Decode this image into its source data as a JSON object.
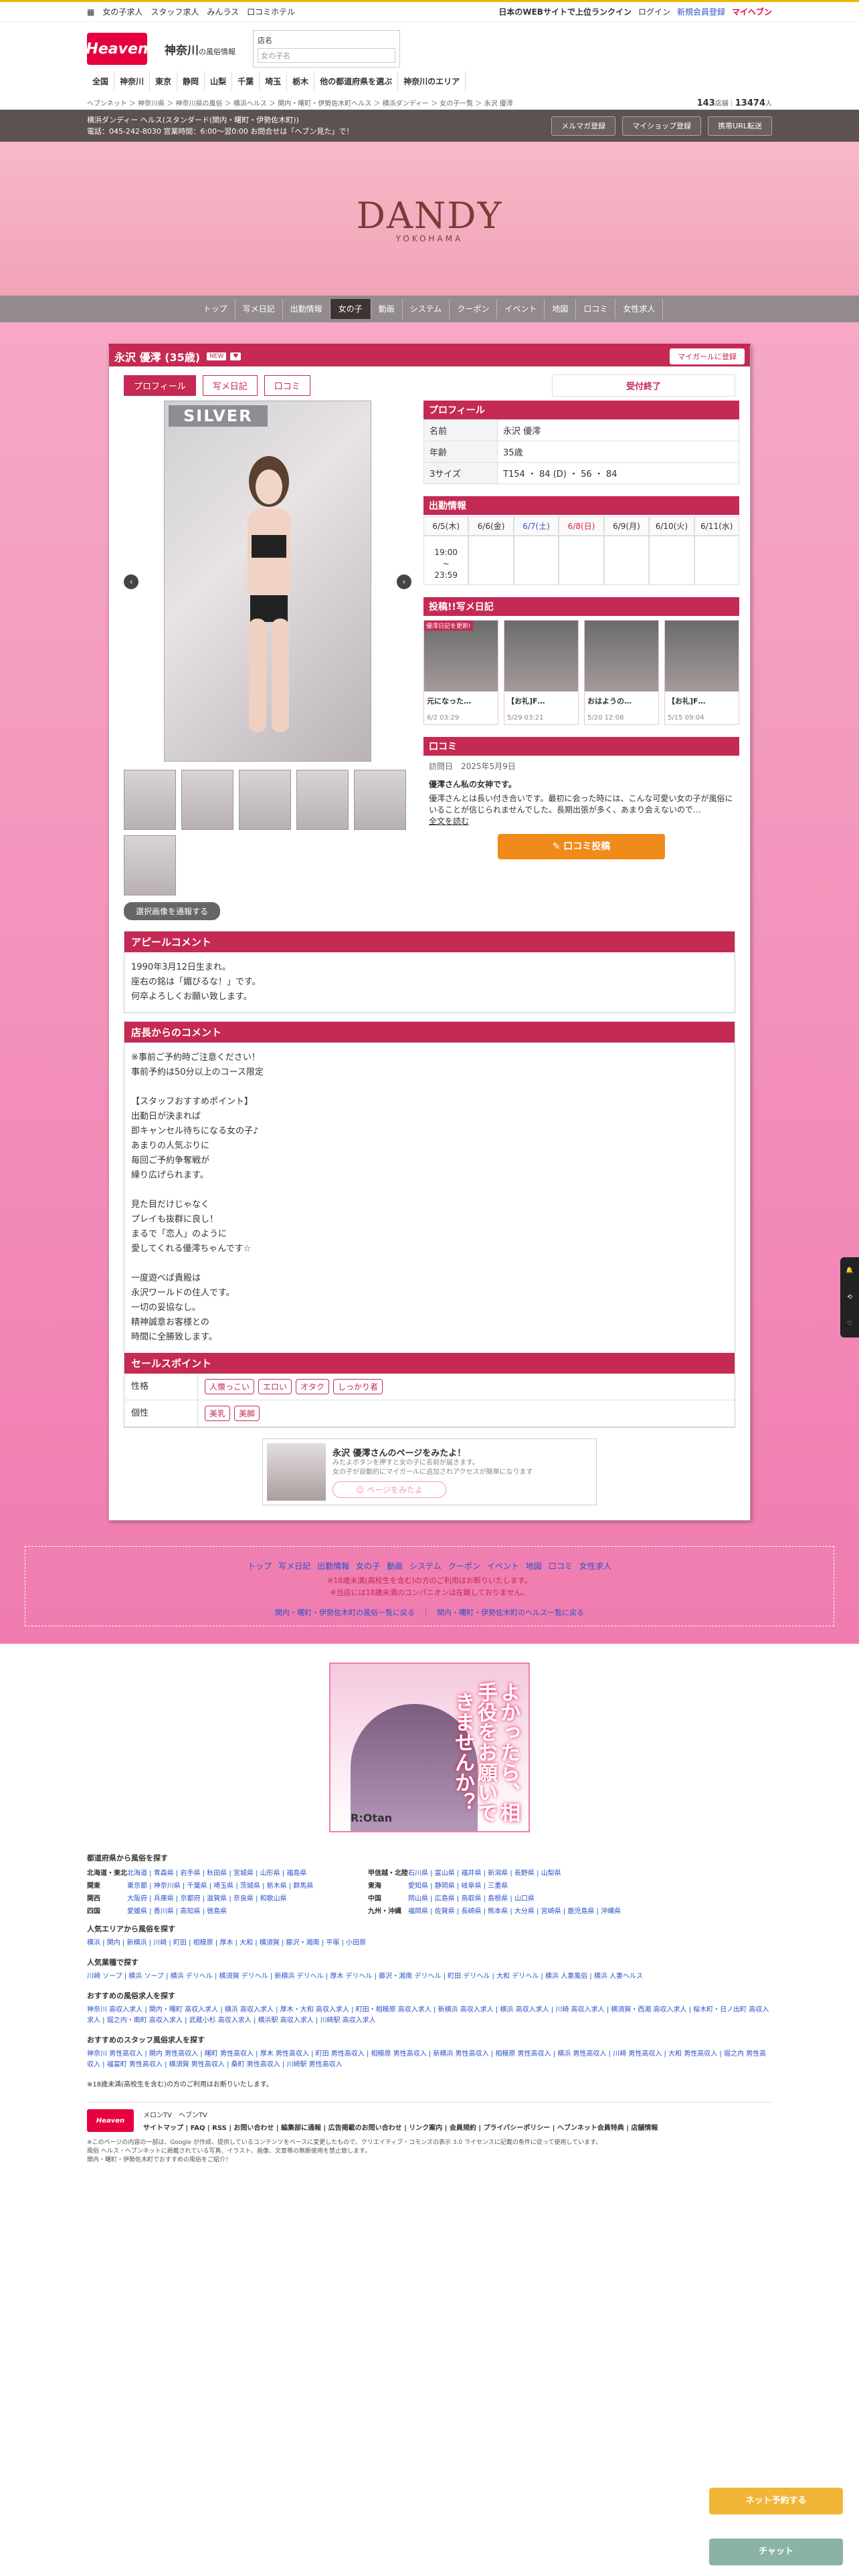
{
  "top": {
    "links": [
      "女の子求人",
      "スタッフ求人",
      "みんラス",
      "口コミホテル"
    ],
    "right_text": "日本のWEBサイトで上位ランクイン",
    "login": "ログイン",
    "register": "新規会員登録",
    "myheaven": "マイヘブン"
  },
  "logo": {
    "text": "Heaven",
    "region": "神奈川",
    "region_sub": "の風俗情報"
  },
  "search": {
    "label": "店名",
    "placeholder": "女の子名"
  },
  "gnav": [
    "全国",
    "神奈川",
    "東京",
    "静岡",
    "山梨",
    "千葉",
    "埼玉",
    "栃木",
    "他の都道府県を選ぶ",
    "神奈川のエリア"
  ],
  "breadcrumb": "ヘブンネット ＞ 神奈川県 ＞ 神奈川県の風俗 ＞ 横浜ヘルス ＞ 関内・曙町・伊勢佐木町ヘルス ＞ 横浜ダンディー ＞ 女の子一覧 ＞ 永沢 優澪",
  "counts": {
    "a": "143",
    "a_unit": "店舗",
    "b": "13474",
    "b_unit": "人"
  },
  "shop": {
    "line1": "横浜ダンディー ヘルス(スタンダード(関内・曙町・伊勢佐木町))",
    "line2": "電話：045-242-8030 営業時間：6:00～翌0:00 お問合せは「ヘブン見た」で！",
    "btn_mail": "メルマガ登録",
    "btn_myshop": "マイショップ登録",
    "btn_url": "携帯URL転送"
  },
  "brand": {
    "name": "DANDY",
    "sub": "YOKOHAMA"
  },
  "snav": [
    "トップ",
    "写メ日記",
    "出勤情報",
    "女の子",
    "動画",
    "システム",
    "クーポン",
    "イベント",
    "地図",
    "口コミ",
    "女性求人"
  ],
  "girl": {
    "name": "永沢 優澪 (35歳)",
    "badges": [
      "NEW",
      "♥"
    ],
    "mag_button": "マイガールに登録"
  },
  "tabs": [
    "プロフィール",
    "写メ日記",
    "口コミ"
  ],
  "status": "受付終了",
  "photo_rank": "SILVER",
  "select_btn": "選択画像を通報する",
  "profile": {
    "title": "プロフィール",
    "rows": [
      {
        "k": "名前",
        "v": "永沢 優澪"
      },
      {
        "k": "年齢",
        "v": "35歳"
      },
      {
        "k": "3サイズ",
        "v": "T154 ・ 84 (D) ・ 56 ・ 84"
      }
    ]
  },
  "schedule": {
    "title": "出勤情報",
    "days": [
      "6/5(木)",
      "6/6(金)",
      "6/7(土)",
      "6/8(日)",
      "6/9(月)",
      "6/10(火)",
      "6/11(水)"
    ],
    "times": [
      "19:00\n~\n23:59",
      "",
      "",
      "",
      "",
      "",
      ""
    ]
  },
  "diary": {
    "title": "投稿!!写メ日記",
    "items": [
      {
        "badge": "優澪日記を更新!",
        "text": "元になった…",
        "date": "6/2 03:29"
      },
      {
        "badge": "",
        "text": "【お礼]F…",
        "date": "5/29 03:21"
      },
      {
        "badge": "",
        "text": "おはようの…",
        "date": "5/20 12:08"
      },
      {
        "badge": "",
        "text": "【お礼]F…",
        "date": "5/15 09:04"
      }
    ]
  },
  "review": {
    "title": "口コミ",
    "meta": "訪問日　2025年5月9日",
    "head": "優澪さん私の女神です。",
    "body": "優澪さんとは長い付き合いです。最初に会った時には、こんな可愛い女の子が風俗にいることが信じられませんでした。長期出張が多く、あまり会えないので…",
    "more": "全文を読む",
    "post": "口コミ投稿"
  },
  "appeal": {
    "title": "アピールコメント",
    "lines": [
      "1990年3月12日生まれ。",
      "座右の銘は「媚びるな！」です。",
      "何卒よろしくお願い致します。"
    ]
  },
  "manager": {
    "title": "店長からのコメント",
    "lines": [
      "※事前ご予約時ご注意ください！",
      "事前予約は50分以上のコース限定",
      "",
      "【スタッフおすすめポイント】",
      "出勤日が決まれば",
      "即キャンセル待ちになる女の子♪",
      "あまりの人気ぶりに",
      "毎回ご予約争奪戦が",
      "繰り広げられます。",
      "",
      "見た目だけじゃなく",
      "プレイも抜群に良し！",
      "まるで「恋人」のように",
      "愛してくれる優澪ちゃんです☆",
      "",
      "一度遊べば貴殿は",
      "永沢ワールドの住人です。",
      "一切の妥協なし。",
      "精神誠意お客様との",
      "時間に全勝致します。"
    ]
  },
  "sales": {
    "title": "セールスポイント",
    "rows": [
      {
        "k": "性格",
        "tags": [
          "人懐っこい",
          "エロい",
          "オタク",
          "しっかり者"
        ]
      },
      {
        "k": "個性",
        "tags": [
          "美乳",
          "美脚"
        ]
      }
    ]
  },
  "banner": {
    "title": "永沢 優澪さんのページをみたよ！",
    "sub1": "みたよボタンを押すと女の子に名前が届きます。",
    "sub2": "女の子が自動的にマイガールに追加されアクセスが簡単になります",
    "btn": "ページをみたよ"
  },
  "shopfoot": {
    "nav": [
      "トップ",
      "写メ日記",
      "出勤情報",
      "女の子",
      "動画",
      "システム",
      "クーポン",
      "イベント",
      "地図",
      "口コミ",
      "女性求人"
    ],
    "note1": "※18歳未満(高校生を含む)の方のご利用はお断りいたします。",
    "note2": "※当店には18歳未満のコンパニオンは在籍しておりません。",
    "link1": "関内・曙町・伊勢佐木町の風俗一覧に戻る",
    "link2": "関内・曙町・伊勢佐木町のヘルス一覧に戻る"
  },
  "ad": {
    "headline": "よかったら、相手役をお願いできませんか？",
    "brand": "R:Otan"
  },
  "site": {
    "h_pref": "都道府県から風俗を探す",
    "prefs": [
      {
        "k": "北海道・東北",
        "v": "北海道 | 青森県 | 岩手県 | 秋田県 | 宮城県 | 山形県 | 福島県"
      },
      {
        "k": "甲信越・北陸",
        "v": "石川県 | 富山県 | 福井県 | 新潟県 | 長野県 | 山梨県"
      },
      {
        "k": "関東",
        "v": "東京都 | 神奈川県 | 千葉県 | 埼玉県 | 茨城県 | 栃木県 | 群馬県"
      },
      {
        "k": "東海",
        "v": "愛知県 | 静岡県 | 岐阜県 | 三重県"
      },
      {
        "k": "関西",
        "v": "大阪府 | 兵庫県 | 京都府 | 滋賀県 | 奈良県 | 和歌山県"
      },
      {
        "k": "中国",
        "v": "岡山県 | 広島県 | 鳥取県 | 島根県 | 山口県"
      },
      {
        "k": "四国",
        "v": "愛媛県 | 香川県 | 高知県 | 徳島県"
      },
      {
        "k": "九州・沖縄",
        "v": "福岡県 | 佐賀県 | 長崎県 | 熊本県 | 大分県 | 宮崎県 | 鹿児島県 | 沖縄県"
      }
    ],
    "h_area": "人気エリアから風俗を探す",
    "areas": "横浜 | 関内 | 新横浜 | 川崎 | 町田 | 相模原 | 厚木 | 大和 | 横須賀 | 藤沢・湘南 | 平塚 | 小田原",
    "h_genre": "人気業種で探す",
    "genres": "川崎 ソープ | 横浜 ソープ | 横浜 デリヘル | 横須賀 デリヘル | 新横浜 デリヘル | 厚木 デリヘル | 藤沢・湘南 デリヘル | 町田 デリヘル | 大和 デリヘル | 横浜 人妻風俗 | 横浜 人妻ヘルス",
    "h_job": "おすすめの風俗求人を探す",
    "jobs": "神奈川 高収入求人 | 関内・曙町 高収入求人 | 横浜 高収入求人 | 厚木・大和 高収入求人 | 町田・相模原 高収入求人 | 新横浜 高収入求人 | 横浜 高収入求人 | 川崎 高収入求人 | 横須賀・西湘 高収入求人 | 桜木町・日ノ出町 高収入求人 | 堀之内・南町 高収入求人 | 武蔵小杉 高収入求人 | 横浜駅 高収入求人 | 川崎駅 高収入求人",
    "h_staff": "おすすめのスタッフ風俗求人を探す",
    "staff": "神奈川 男性高収入 | 関内 男性高収入 | 曙町 男性高収入 | 厚木 男性高収入 | 町田 男性高収入 | 相模原 男性高収入 | 新横浜 男性高収入 | 相模原 男性高収入 | 横浜 男性高収入 | 川崎 男性高収入 | 大和 男性高収入 | 堀之内 男性高収入 | 福富町 男性高収入 | 横須賀 男性高収入 | 桑町 男性高収入 | 川崎駅 男性高収入",
    "age_note": "※18歳未満(高校生を含む)の方のご利用はお断りいたします。",
    "logo": "Heaven",
    "mlinks": [
      "メロンTV",
      "ヘブンTV"
    ],
    "flinks": "サイトマップ | FAQ | RSS | お問い合わせ | 編集部に通報 | 広告掲載のお問い合わせ | リンク案内 | 会員規約 | プライバシーポリシー | ヘブンネット会員特典 | 店舗情報",
    "copy1": "※このページの内容の一部は、Google が作成、提供しているコンテンツをベースに変更したもので、クリエイティブ・コモンズの表示 3.0 ライセンスに記載の条件に従って使用しています。",
    "copy2": "風俗 ヘルス・ヘブンネットに掲載されている写真、イラスト、画像、文章等の無断使用を禁止致します。",
    "copy3": "関内・曙町・伊勢佐木町でおすすめの風俗をご紹介！"
  },
  "float": {
    "a": "ネット予約する",
    "b": "チャット"
  }
}
